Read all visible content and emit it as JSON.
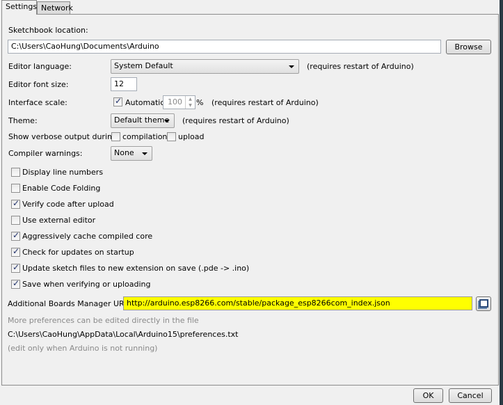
{
  "tabs": [
    {
      "label": "Settings",
      "active": true
    },
    {
      "label": "Network",
      "active": false
    }
  ],
  "sketchbook": {
    "label": "Sketchbook location:",
    "value": "C:\\Users\\CaoHung\\Documents\\Arduino",
    "browse": "Browse"
  },
  "language": {
    "label": "Editor language:",
    "value": "System Default",
    "note": "(requires restart of Arduino)"
  },
  "font_size": {
    "label": "Editor font size:",
    "value": "12"
  },
  "scale": {
    "label": "Interface scale:",
    "auto_label": "Automatic",
    "auto_checked": true,
    "value": "100",
    "unit": "%",
    "note": "(requires restart of Arduino)"
  },
  "theme": {
    "label": "Theme:",
    "value": "Default theme",
    "note": "(requires restart of Arduino)"
  },
  "verbose": {
    "label": "Show verbose output during:",
    "compilation": "compilation",
    "compilation_checked": false,
    "upload": "upload",
    "upload_checked": false
  },
  "warnings": {
    "label": "Compiler warnings:",
    "value": "None"
  },
  "options": [
    {
      "label": "Display line numbers",
      "checked": false
    },
    {
      "label": "Enable Code Folding",
      "checked": false
    },
    {
      "label": "Verify code after upload",
      "checked": true
    },
    {
      "label": "Use external editor",
      "checked": false
    },
    {
      "label": "Aggressively cache compiled core",
      "checked": true
    },
    {
      "label": "Check for updates on startup",
      "checked": true
    },
    {
      "label": "Update sketch files to new extension on save (.pde -> .ino)",
      "checked": true
    },
    {
      "label": "Save when verifying or uploading",
      "checked": true
    }
  ],
  "boards": {
    "label": "Additional Boards Manager URLs:",
    "value": "http://arduino.esp8266.com/stable/package_esp8266com_index.json",
    "highlight": "#ffff00"
  },
  "footer": {
    "more": "More preferences can be edited directly in the file",
    "path": "C:\\Users\\CaoHung\\AppData\\Local\\Arduino15\\preferences.txt",
    "note": "(edit only when Arduino is not running)"
  },
  "buttons": {
    "ok": "OK",
    "cancel": "Cancel"
  }
}
